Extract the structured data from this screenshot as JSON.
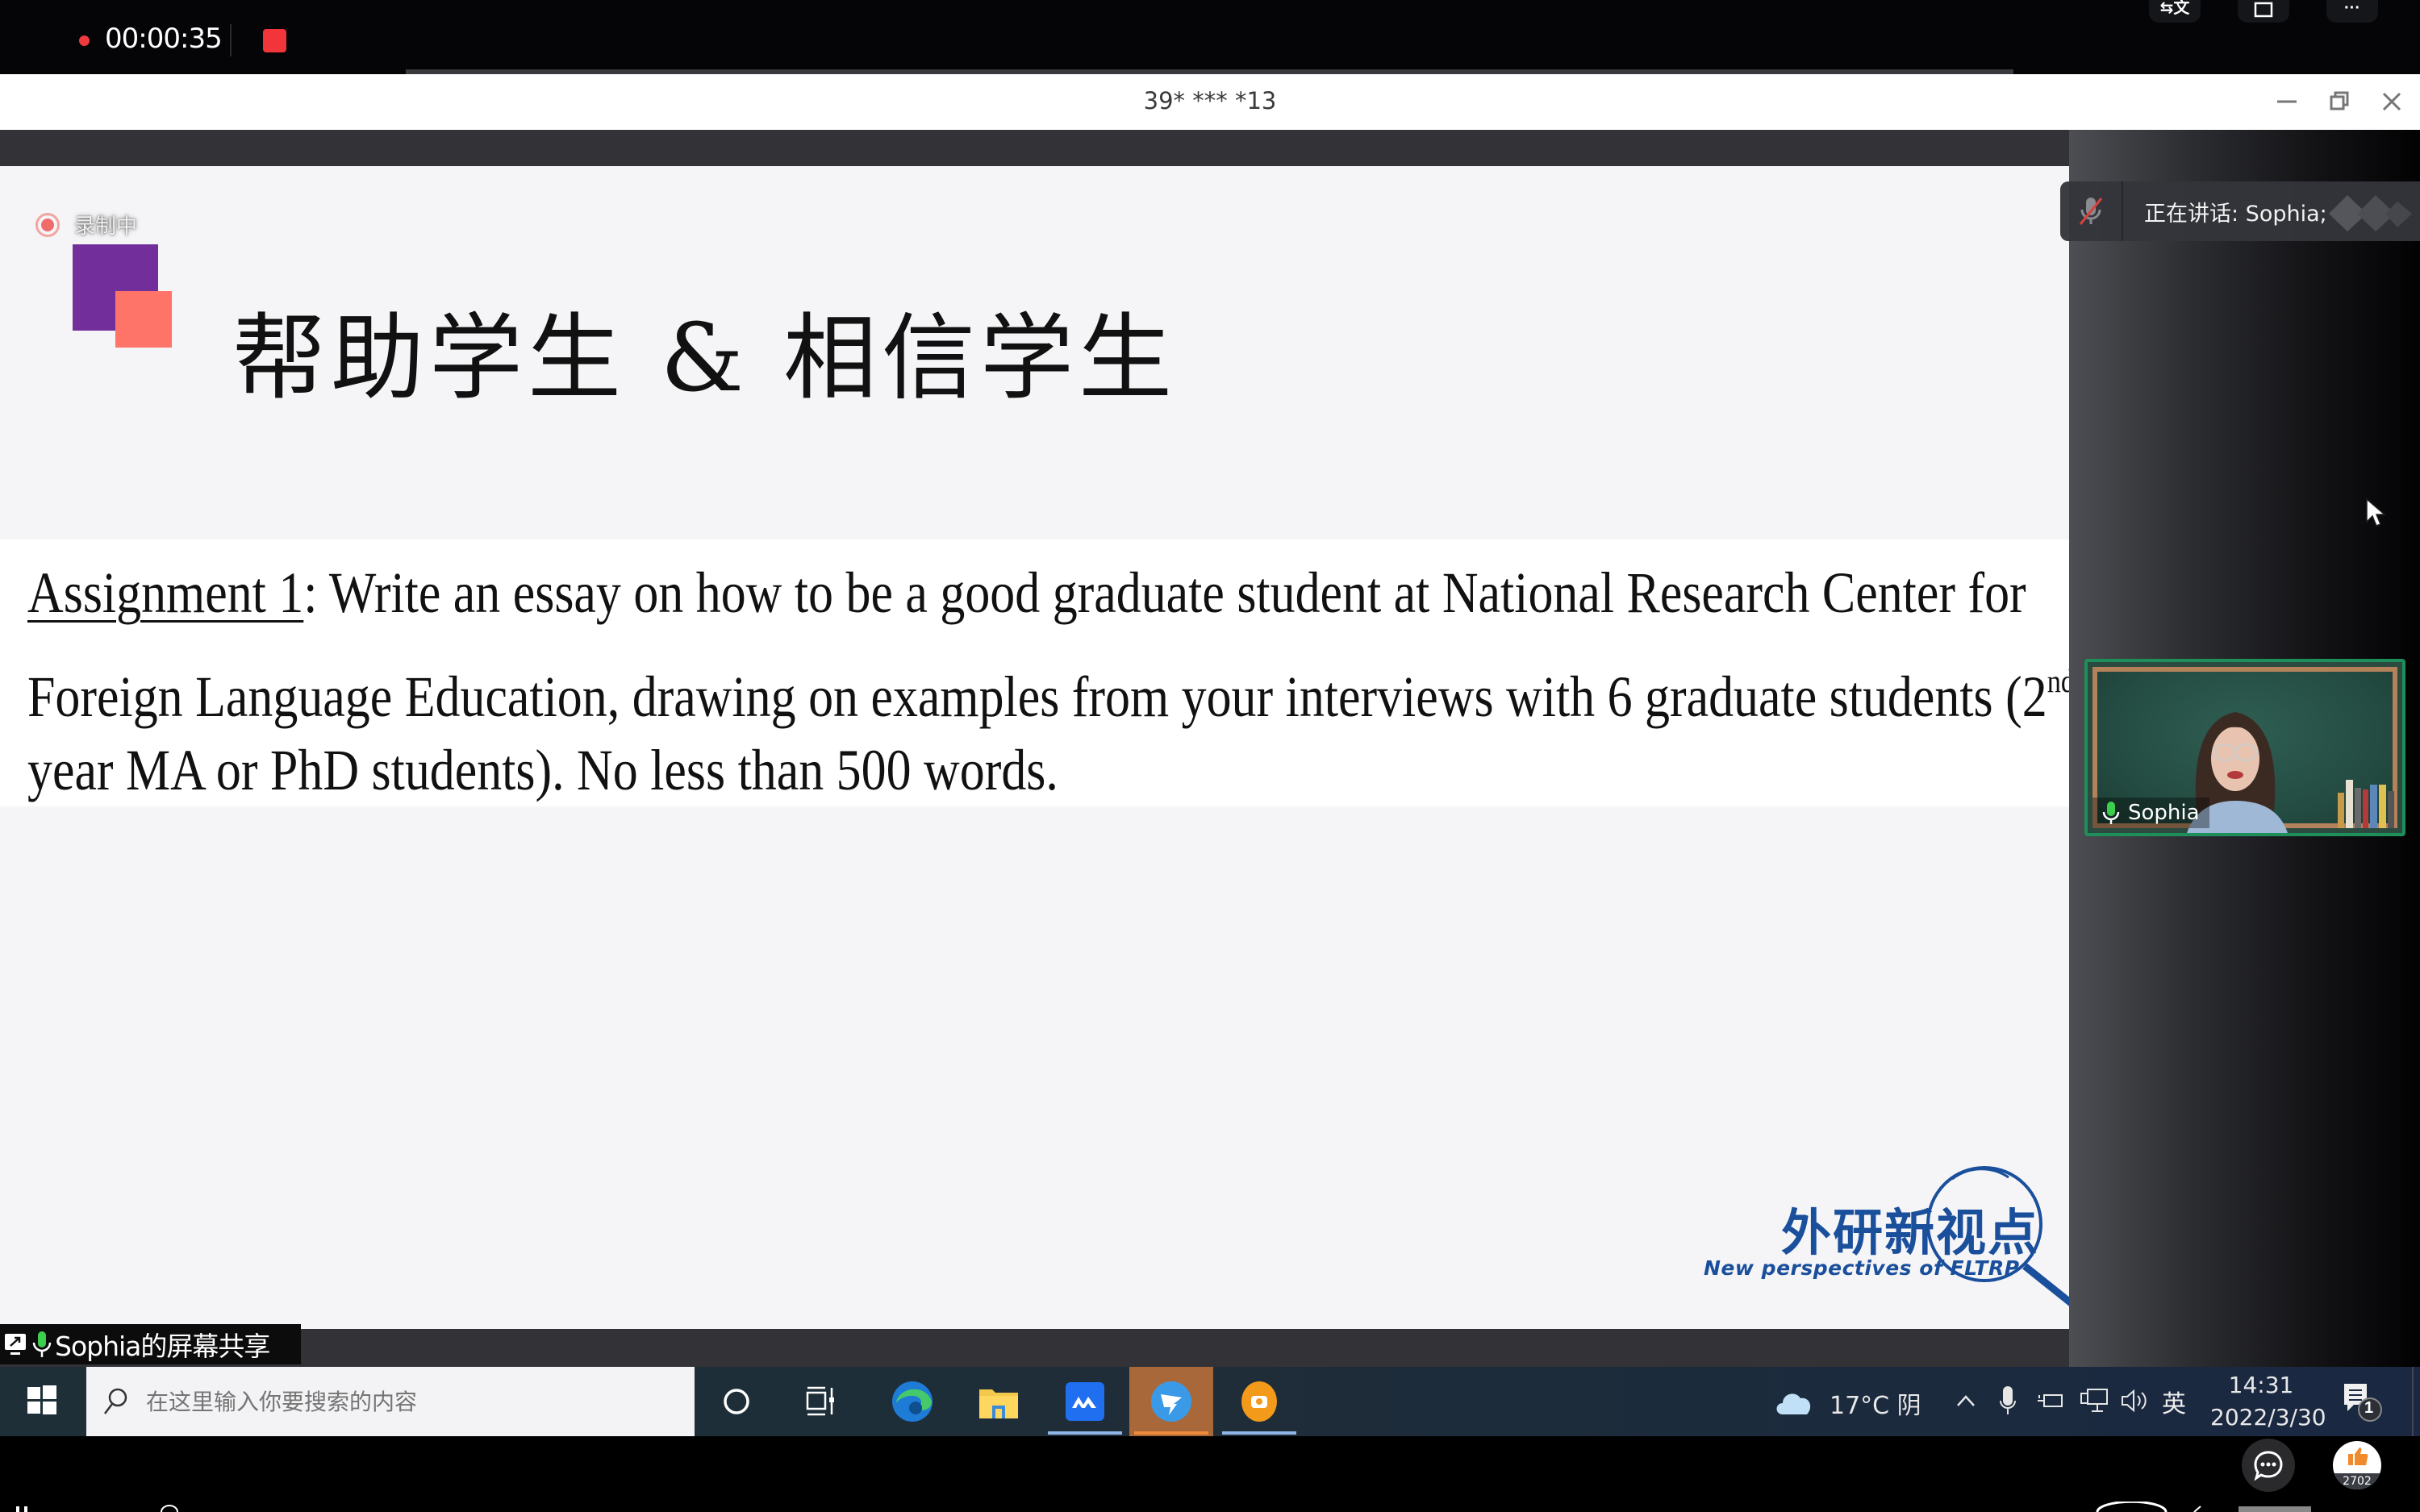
{
  "recording_bar": {
    "elapsed": "00:00:35",
    "buttons": [
      "translate-icon",
      "window-icon",
      "more-icon"
    ],
    "more_label": "···"
  },
  "window": {
    "title": "39* *** *13",
    "controls": [
      "minimize",
      "restore",
      "close"
    ]
  },
  "slide": {
    "recording_label": "录制中",
    "title": "帮助学生 & 相信学生",
    "body": {
      "label": "Assignment 1",
      "line1_rest": ": Write an essay on how to be a good graduate student at National Research Center for",
      "line2": "Foreign Language Education, drawing on examples from your interviews with 6 graduate students (2",
      "line2_sup": "nd",
      "line3": "year MA or PhD students). No less than 500 words."
    },
    "logo": {
      "cn": "外研新视点",
      "en": "New perspectives of FLTRP"
    },
    "colors": {
      "purple": "#722e9a",
      "salmon": "#ff7468",
      "logo_blue": "#1a4f9c"
    }
  },
  "meeting": {
    "speaking_label": "正在讲话: Sophia;",
    "participant": {
      "name": "Sophia",
      "mic": "on"
    },
    "screen_share_label": "Sophia的屏幕共享"
  },
  "taskbar": {
    "search_placeholder": "在这里输入你要搜索的内容",
    "pinned": [
      "cortana",
      "task-view",
      "edge",
      "file-explorer",
      "app-blue",
      "dingtalk",
      "app-orange"
    ],
    "active_app": "dingtalk",
    "weather": "17°C 阴",
    "input_lang": "英",
    "time": "14:31",
    "date": "2022/3/30",
    "notification_count": "1"
  },
  "overlay": {
    "like_count": "2702"
  }
}
